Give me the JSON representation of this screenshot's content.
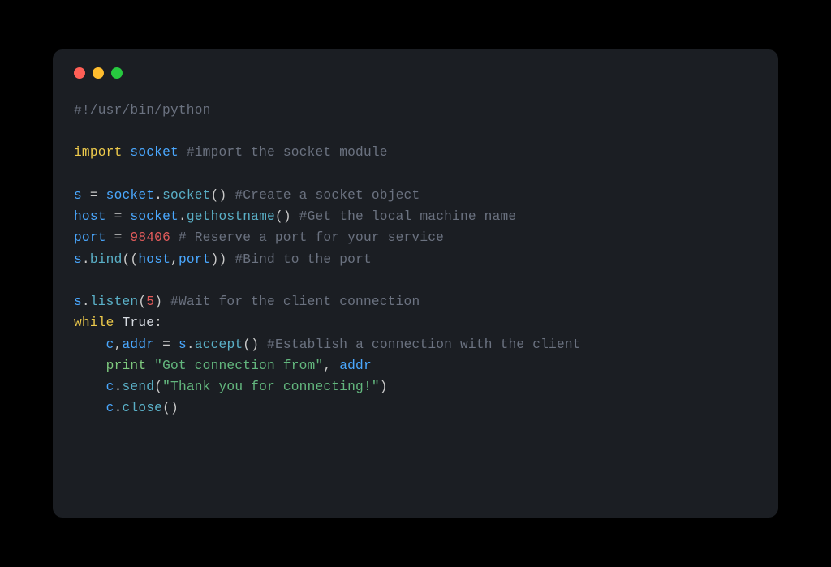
{
  "code": {
    "lines": [
      [
        {
          "cls": "tok-comment",
          "t": "#!/usr/bin/python"
        }
      ],
      [],
      [
        {
          "cls": "tok-keyword",
          "t": "import"
        },
        {
          "cls": "tok-default",
          "t": " "
        },
        {
          "cls": "tok-module",
          "t": "socket"
        },
        {
          "cls": "tok-default",
          "t": " "
        },
        {
          "cls": "tok-comment",
          "t": "#import the socket module"
        }
      ],
      [],
      [
        {
          "cls": "tok-var",
          "t": "s"
        },
        {
          "cls": "tok-punct",
          "t": " = "
        },
        {
          "cls": "tok-var",
          "t": "socket"
        },
        {
          "cls": "tok-punct",
          "t": "."
        },
        {
          "cls": "tok-call",
          "t": "socket"
        },
        {
          "cls": "tok-punct",
          "t": "() "
        },
        {
          "cls": "tok-comment",
          "t": "#Create a socket object"
        }
      ],
      [
        {
          "cls": "tok-var",
          "t": "host"
        },
        {
          "cls": "tok-punct",
          "t": " = "
        },
        {
          "cls": "tok-var",
          "t": "socket"
        },
        {
          "cls": "tok-punct",
          "t": "."
        },
        {
          "cls": "tok-call",
          "t": "gethostname"
        },
        {
          "cls": "tok-punct",
          "t": "() "
        },
        {
          "cls": "tok-comment",
          "t": "#Get the local machine name"
        }
      ],
      [
        {
          "cls": "tok-var",
          "t": "port"
        },
        {
          "cls": "tok-punct",
          "t": " = "
        },
        {
          "cls": "tok-number",
          "t": "98406"
        },
        {
          "cls": "tok-default",
          "t": " "
        },
        {
          "cls": "tok-comment",
          "t": "# Reserve a port for your service"
        }
      ],
      [
        {
          "cls": "tok-var",
          "t": "s"
        },
        {
          "cls": "tok-punct",
          "t": "."
        },
        {
          "cls": "tok-call",
          "t": "bind"
        },
        {
          "cls": "tok-punct",
          "t": "(("
        },
        {
          "cls": "tok-var",
          "t": "host"
        },
        {
          "cls": "tok-punct",
          "t": ","
        },
        {
          "cls": "tok-var",
          "t": "port"
        },
        {
          "cls": "tok-punct",
          "t": ")) "
        },
        {
          "cls": "tok-comment",
          "t": "#Bind to the port"
        }
      ],
      [],
      [
        {
          "cls": "tok-var",
          "t": "s"
        },
        {
          "cls": "tok-punct",
          "t": "."
        },
        {
          "cls": "tok-call",
          "t": "listen"
        },
        {
          "cls": "tok-punct",
          "t": "("
        },
        {
          "cls": "tok-number",
          "t": "5"
        },
        {
          "cls": "tok-punct",
          "t": ") "
        },
        {
          "cls": "tok-comment",
          "t": "#Wait for the client connection"
        }
      ],
      [
        {
          "cls": "tok-keyword",
          "t": "while"
        },
        {
          "cls": "tok-default",
          "t": " "
        },
        {
          "cls": "tok-bool",
          "t": "True"
        },
        {
          "cls": "tok-punct",
          "t": ":"
        }
      ],
      [
        {
          "cls": "tok-default",
          "t": "    "
        },
        {
          "cls": "tok-var",
          "t": "c"
        },
        {
          "cls": "tok-punct",
          "t": ","
        },
        {
          "cls": "tok-var",
          "t": "addr"
        },
        {
          "cls": "tok-punct",
          "t": " = "
        },
        {
          "cls": "tok-var",
          "t": "s"
        },
        {
          "cls": "tok-punct",
          "t": "."
        },
        {
          "cls": "tok-call",
          "t": "accept"
        },
        {
          "cls": "tok-punct",
          "t": "() "
        },
        {
          "cls": "tok-comment",
          "t": "#Establish a connection with the client"
        }
      ],
      [
        {
          "cls": "tok-default",
          "t": "    "
        },
        {
          "cls": "tok-print",
          "t": "print"
        },
        {
          "cls": "tok-default",
          "t": " "
        },
        {
          "cls": "tok-string",
          "t": "\"Got connection from\""
        },
        {
          "cls": "tok-punct",
          "t": ", "
        },
        {
          "cls": "tok-var",
          "t": "addr"
        }
      ],
      [
        {
          "cls": "tok-default",
          "t": "    "
        },
        {
          "cls": "tok-var",
          "t": "c"
        },
        {
          "cls": "tok-punct",
          "t": "."
        },
        {
          "cls": "tok-call",
          "t": "send"
        },
        {
          "cls": "tok-punct",
          "t": "("
        },
        {
          "cls": "tok-string",
          "t": "\"Thank you for connecting!\""
        },
        {
          "cls": "tok-punct",
          "t": ")"
        }
      ],
      [
        {
          "cls": "tok-default",
          "t": "    "
        },
        {
          "cls": "tok-var",
          "t": "c"
        },
        {
          "cls": "tok-punct",
          "t": "."
        },
        {
          "cls": "tok-call",
          "t": "close"
        },
        {
          "cls": "tok-punct",
          "t": "()"
        }
      ]
    ]
  }
}
